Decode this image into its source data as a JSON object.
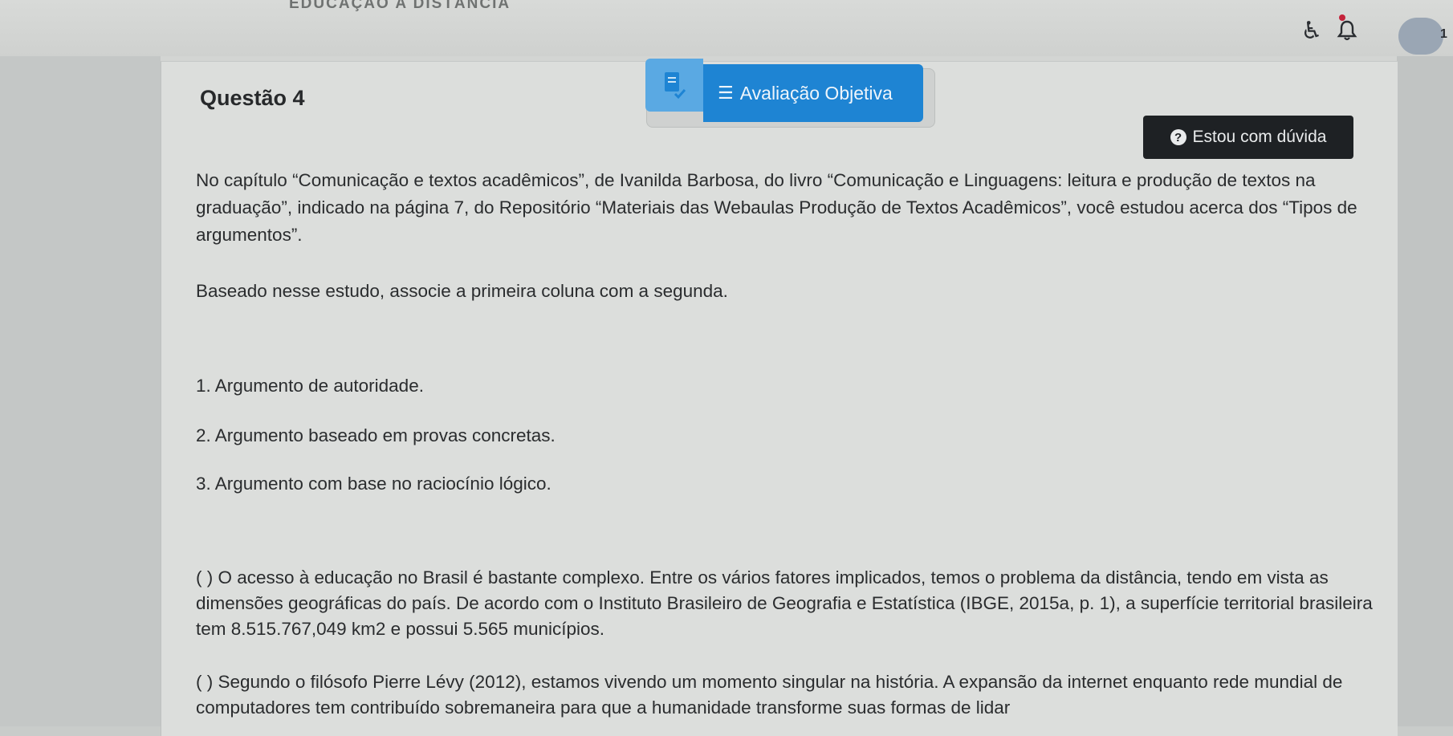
{
  "header": {
    "title": "EDUCAÇÃO A DISTÂNCIA",
    "accessibility_icon": "accessibility-icon",
    "bell_icon": "bell-icon",
    "avatar_badge": "1"
  },
  "question": {
    "title": "Questão 4",
    "type_label": "Avaliação Objetiva",
    "doubt_button": "Estou com dúvida",
    "doubt_icon": "?",
    "intro": "No capítulo “Comunicação e textos acadêmicos”, de Ivanilda Barbosa, do livro “Comunicação e Linguagens: leitura e produção de textos na graduação”, indicado na página 7, do Repositório “Materiais das Webaulas Produção de Textos Acadêmicos”, você estudou acerca dos “Tipos de argumentos”.",
    "instruction": "Baseado nesse estudo, associe a primeira coluna com a segunda.",
    "column_one": [
      "1. Argumento de autoridade.",
      "2. Argumento baseado em provas concretas.",
      "3. Argumento com base no raciocínio lógico."
    ],
    "statements": [
      "( ) O acesso à educação no Brasil é bastante complexo. Entre os vários fatores implicados, temos o problema da distância, tendo em vista as dimensões geográficas do país. De acordo com o Instituto Brasileiro de Geografia e Estatística (IBGE, 2015a, p. 1), a superfície territorial brasileira tem 8.515.767,049 km2 e possui 5.565 municípios.",
      "( ) Segundo o filósofo Pierre Lévy (2012), estamos vivendo um momento singular na história. A expansão da internet enquanto rede mundial de computadores tem contribuído sobremaneira para que a humanidade transforme suas formas de lidar"
    ]
  },
  "colors": {
    "primary": "#1e84d3",
    "primary_light": "#5aa9e3",
    "dark_button": "#1e2124",
    "page_bg": "#d3d5d3"
  }
}
